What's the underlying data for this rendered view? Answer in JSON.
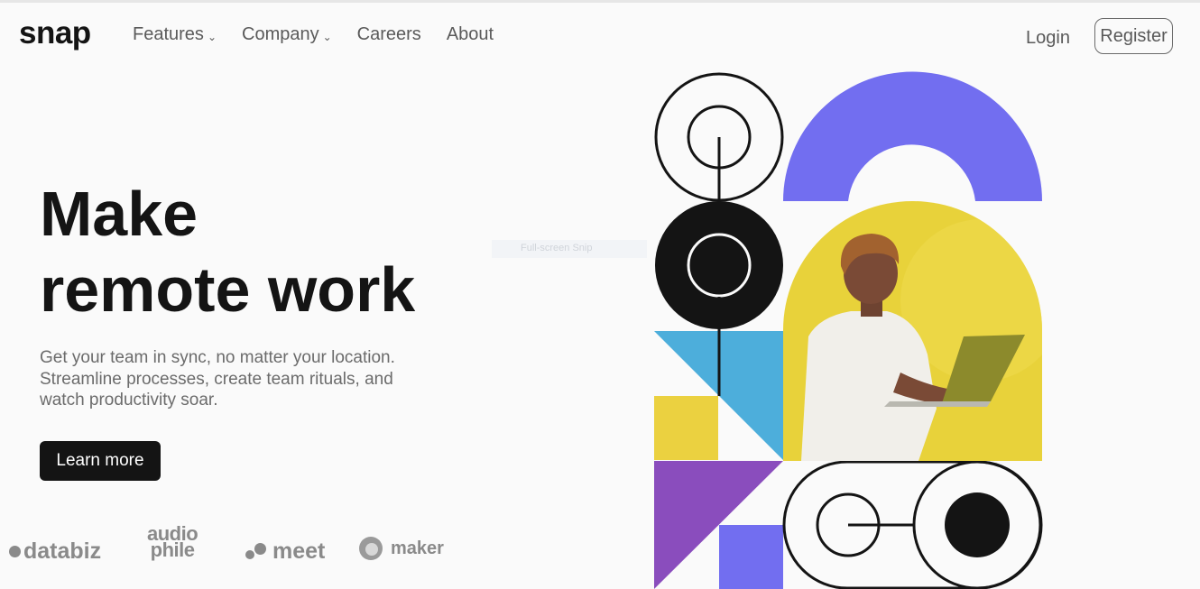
{
  "header": {
    "logo": "snap",
    "nav": [
      {
        "label": "Features",
        "has_dropdown": true
      },
      {
        "label": "Company",
        "has_dropdown": true
      },
      {
        "label": "Careers",
        "has_dropdown": false
      },
      {
        "label": "About",
        "has_dropdown": false
      }
    ],
    "login_label": "Login",
    "register_label": "Register",
    "chevron": "⌄"
  },
  "hero": {
    "title_line1": "Make",
    "title_line2": "remote work",
    "description": "Get your team in sync, no matter your location. Streamline processes, create team rituals, and watch productivity soar.",
    "cta_label": "Learn more"
  },
  "clients": {
    "databiz": "databiz",
    "audiophile_line1": "audio",
    "audiophile_line2": "phile",
    "meet": "meet",
    "maker": "maker"
  },
  "tooltip": "Full-screen Snip",
  "colors": {
    "purple": "#726ef0",
    "yellow": "#ebd140",
    "blue": "#4daedb",
    "violet": "#8a4dbd",
    "dark": "#141414"
  }
}
